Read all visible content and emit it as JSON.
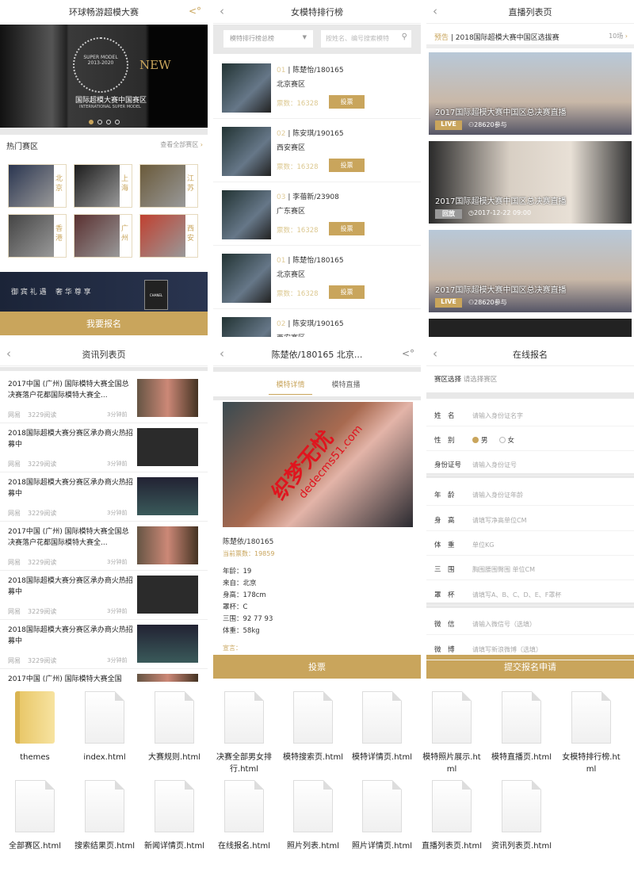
{
  "colors": {
    "accent": "#c9a55c",
    "gap": "#e8e8e8"
  },
  "home": {
    "title": "环球畅游超模大赛",
    "share_icon": "share-icon",
    "banner": {
      "new": "NEW",
      "logo_lines": [
        "INTERNATIONAL",
        "SUPER MODEL",
        "CONTEST",
        "2013-2020"
      ],
      "cn": "国际超模大赛中国赛区",
      "en": "INTERNATIONAL SUPER MODEL"
    },
    "slides": 4,
    "active_slide": 1,
    "section_title": "热门赛区",
    "section_more": "查看全部赛区",
    "regions": [
      "北京",
      "上海",
      "江苏",
      "香港",
      "广州",
      "西安"
    ],
    "ad": {
      "text": "御 宾 礼 遇    奢 华 尊 享",
      "brand": "CHANEL"
    },
    "signup": "我要报名"
  },
  "ranking": {
    "title": "女模特排行榜",
    "select": "模特排行榜总榜",
    "search_placeholder": "按姓名、编号搜索模特",
    "items": [
      {
        "rank": "01",
        "name": "陈楚怡/180165",
        "region": "北京赛区",
        "votes_label": "票数：",
        "votes": "16328",
        "vote": "投票"
      },
      {
        "rank": "02",
        "name": "陈安琪/190165",
        "region": "西安赛区",
        "votes_label": "票数：",
        "votes": "16328",
        "vote": "投票"
      },
      {
        "rank": "03",
        "name": "李蓓新/23908",
        "region": "广东赛区",
        "votes_label": "票数：",
        "votes": "16328",
        "vote": "投票"
      },
      {
        "rank": "01",
        "name": "陈楚怡/180165",
        "region": "北京赛区",
        "votes_label": "票数：",
        "votes": "16328",
        "vote": "投票"
      },
      {
        "rank": "02",
        "name": "陈安琪/190165",
        "region": "西安赛区",
        "votes_label": "票数：",
        "votes": "16328",
        "vote": "投票"
      }
    ]
  },
  "live": {
    "title": "直播列表页",
    "notice_tag": "预告",
    "notice": "2018国际超模大赛中国区选拔赛",
    "notice_count": "10场",
    "cards": [
      {
        "title": "2017国际超模大赛中国区总决赛直播",
        "badge": "LIVE",
        "meta": "28620参与"
      },
      {
        "title": "2017国际超模大赛中国区总决赛直播",
        "badge": "回放",
        "meta": "2017-12-22 09:00"
      },
      {
        "title": "2017国际超模大赛中国区总决赛直播",
        "badge": "LIVE",
        "meta": "28620参与"
      }
    ]
  },
  "news": {
    "title": "资讯列表页",
    "items": [
      {
        "title": "2017中国 (广州) 国际模特大赛全国总决赛落户花都国际模特大赛全...",
        "source": "网易",
        "reads": "3229阅读",
        "time": "3分钟前"
      },
      {
        "title": "2018国际超模大赛分赛区承办商火热招募中",
        "source": "网易",
        "reads": "3229阅读",
        "time": "3分钟前"
      },
      {
        "title": "2018国际超模大赛分赛区承办商火热招募中",
        "source": "网易",
        "reads": "3229阅读",
        "time": "3分钟前"
      },
      {
        "title": "2017中国 (广州) 国际模特大赛全国总决赛落户花都国际模特大赛全...",
        "source": "网易",
        "reads": "3229阅读",
        "time": "3分钟前"
      },
      {
        "title": "2018国际超模大赛分赛区承办商火热招募中",
        "source": "网易",
        "reads": "3229阅读",
        "time": "3分钟前"
      },
      {
        "title": "2018国际超模大赛分赛区承办商火热招募中",
        "source": "网易",
        "reads": "3229阅读",
        "time": "3分钟前"
      },
      {
        "title": "2017中国 (广州) 国际模特大赛全国",
        "source": "",
        "reads": "",
        "time": ""
      }
    ]
  },
  "detail": {
    "title": "陈楚依/180165 北京...",
    "tabs": [
      "模特详情",
      "模特直播"
    ],
    "active_tab": 0,
    "name": "陈楚依/180165",
    "votes": "当前票数：19859",
    "info": [
      "年龄：19",
      "来自：北京",
      "身高：178cm",
      "罩杯：C",
      "三围：92 77 93",
      "体重：58kg"
    ],
    "manifesto": "宣言：",
    "vote": "投票",
    "watermark": [
      "织梦无忧",
      "dedecms51.com"
    ]
  },
  "signup": {
    "title": "在线报名",
    "region_label": "赛区选择",
    "region_placeholder": "请选择赛区",
    "fields": [
      {
        "label": "姓　名",
        "placeholder": "请输入身份证名字"
      },
      {
        "label": "性　别",
        "options": [
          "男",
          "女"
        ],
        "selected": 0
      },
      {
        "label": "身份证号",
        "placeholder": "请输入身份证号"
      },
      {
        "label": "年　龄",
        "placeholder": "请输入身份证年龄"
      },
      {
        "label": "身　高",
        "placeholder": "请填写净高单位CM"
      },
      {
        "label": "体　重",
        "placeholder": "单位KG"
      },
      {
        "label": "三　围",
        "placeholder": "胸围腰围臀围 单位CM"
      },
      {
        "label": "罩　杯",
        "placeholder": "请填写A、B、C、D、E、F罩杯"
      },
      {
        "label": "微　信",
        "placeholder": "请输入微信号（选填）"
      },
      {
        "label": "微　博",
        "placeholder": "请填写新浪微博（选填）"
      }
    ],
    "submit": "提交报名申请"
  },
  "files": [
    {
      "name": "themes",
      "type": "folder"
    },
    {
      "name": "index.html",
      "type": "file"
    },
    {
      "name": "大赛规则.html",
      "type": "file"
    },
    {
      "name": "决赛全部男女排行.html",
      "type": "file"
    },
    {
      "name": "模特搜索页.html",
      "type": "file"
    },
    {
      "name": "模特详情页.html",
      "type": "file"
    },
    {
      "name": "模特照片展示.html",
      "type": "file"
    },
    {
      "name": "模特直播页.html",
      "type": "file"
    },
    {
      "name": "女模特排行榜.html",
      "type": "file"
    },
    {
      "name": "全部赛区.html",
      "type": "file"
    },
    {
      "name": "搜索结果页.html",
      "type": "file"
    },
    {
      "name": "新闻详情页.html",
      "type": "file"
    },
    {
      "name": "在线报名.html",
      "type": "file"
    },
    {
      "name": "照片列表.html",
      "type": "file"
    },
    {
      "name": "照片详情页.html",
      "type": "file"
    },
    {
      "name": "直播列表页.html",
      "type": "file"
    },
    {
      "name": "资讯列表页.html",
      "type": "file"
    }
  ]
}
